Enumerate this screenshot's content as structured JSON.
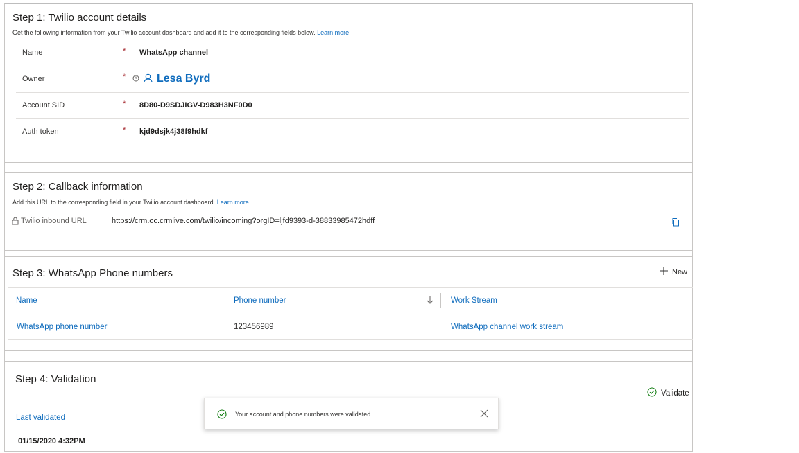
{
  "step1": {
    "title": "Step 1: Twilio account details",
    "desc": "Get the following information from your Twilio account dashboard and add it to the corresponding fields below.",
    "learn_more": "Learn more",
    "fields": [
      {
        "label": "Name",
        "value": "WhatsApp channel"
      },
      {
        "label": "Owner",
        "value": "Lesa Byrd"
      },
      {
        "label": "Account SID",
        "value": "8D80-D9SDJIGV-D983H3NF0D0"
      },
      {
        "label": "Auth token",
        "value": "kjd9dsjk4j38f9hdkf"
      }
    ],
    "required_mark": "*"
  },
  "step2": {
    "title": "Step 2: Callback information",
    "desc": "Add this URL to the corresponding field in your Twilio account dashboard.",
    "learn_more": "Learn more",
    "url_label": "Twilio inbound URL",
    "url_value": "https://crm.oc.crmlive.com/twilio/incoming?orgID=ljfd9393-d-38833985472hdff"
  },
  "step3": {
    "title": "Step 3: WhatsApp Phone numbers",
    "new_label": "New",
    "columns": [
      "Name",
      "Phone number",
      "Work Stream"
    ],
    "rows": [
      {
        "name": "WhatsApp phone number",
        "phone": "123456989",
        "workstream": "WhatsApp channel work stream"
      }
    ]
  },
  "step4": {
    "title": "Step 4: Validation",
    "validate_label": "Validate",
    "column": "Last validated",
    "value": "01/15/2020 4:32PM"
  },
  "toast": {
    "message": "Your account and phone numbers were validated."
  },
  "colors": {
    "accent": "#0f6cbd",
    "required": "#a4262c",
    "success": "#107c10"
  }
}
